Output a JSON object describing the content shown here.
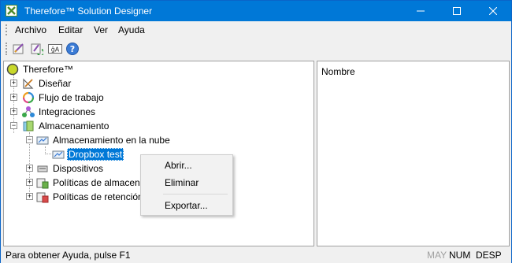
{
  "window": {
    "title": "Therefore™ Solution Designer",
    "accent": "#0078d7"
  },
  "menu": {
    "items": [
      {
        "label": "Archivo"
      },
      {
        "label": "Editar"
      },
      {
        "label": "Ver"
      },
      {
        "label": "Ayuda"
      }
    ]
  },
  "toolbar": {
    "buttons": [
      {
        "icon": "designer-icon"
      },
      {
        "icon": "refresh-icon"
      },
      {
        "icon": "language-icon",
        "text": "ĝA"
      },
      {
        "icon": "help-icon",
        "text": "?"
      }
    ]
  },
  "tree": {
    "root": "Therefore™",
    "nodes": [
      {
        "label": "Diseñar",
        "icon": "design-icon"
      },
      {
        "label": "Flujo de trabajo",
        "icon": "workflow-icon"
      },
      {
        "label": "Integraciones",
        "icon": "integrations-icon"
      },
      {
        "label": "Almacenamiento",
        "icon": "storage-icon"
      },
      {
        "label": "Almacenamiento en la nube",
        "icon": "cloud-storage-icon"
      },
      {
        "label": "Dropbox test",
        "icon": "dropbox-icon",
        "selected": true
      },
      {
        "label": "Dispositivos",
        "icon": "devices-icon"
      },
      {
        "label": "Políticas de almacenamiento",
        "icon": "storage-policy-icon"
      },
      {
        "label": "Políticas de retención",
        "icon": "retention-policy-icon"
      }
    ]
  },
  "list": {
    "column_header": "Nombre"
  },
  "context_menu": {
    "items": [
      {
        "label": "Abrir..."
      },
      {
        "label": "Eliminar"
      },
      {
        "label": "Exportar..."
      }
    ]
  },
  "status": {
    "text": "Para obtener Ayuda, pulse F1",
    "indicators": [
      {
        "label": "MAY",
        "active": false
      },
      {
        "label": "NUM",
        "active": true
      },
      {
        "label": "DESP",
        "active": true
      }
    ]
  }
}
